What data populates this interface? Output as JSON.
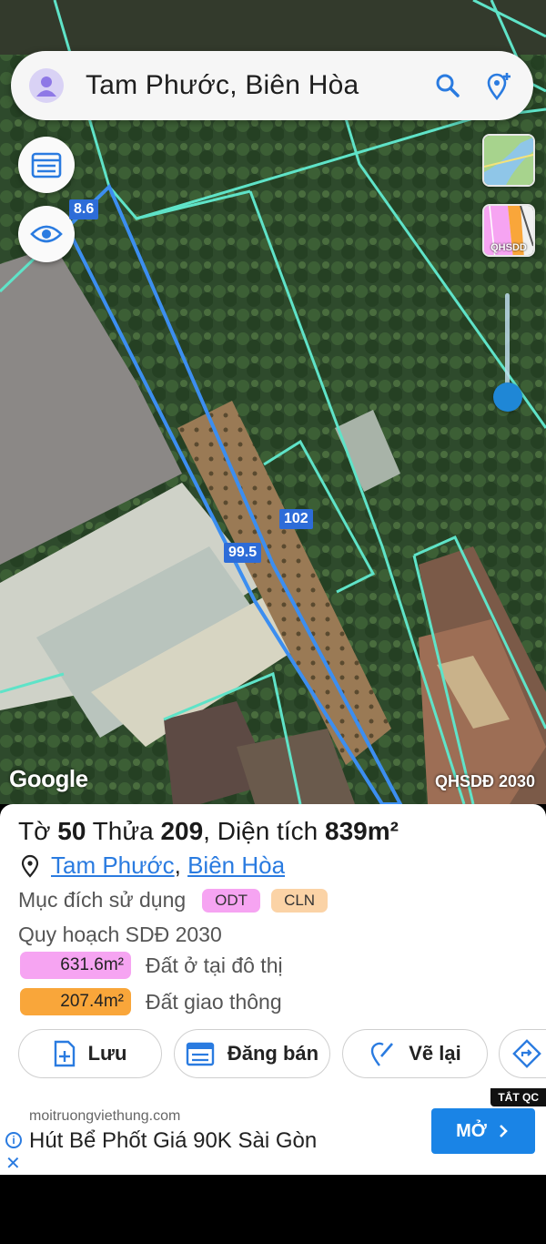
{
  "search": {
    "title": "Tam Phước, Biên Hòa"
  },
  "map": {
    "edge_labels": [
      "8.6",
      "102",
      "99.5"
    ],
    "layer_thumb_label": "QHSDD",
    "google_logo": "Google",
    "plan_badge": "QHSDĐ 2030",
    "colors": {
      "parcel_line": "#5fe3c8",
      "selected_parcel": "#3c8ef0"
    }
  },
  "parcel": {
    "title_prefix": "Tờ ",
    "sheet_no": "50",
    "parcel_prefix": " Thửa ",
    "parcel_no": "209",
    "area_prefix": ", Diện tích ",
    "area": "839m²",
    "ward": "Tam Phước",
    "separator": ",",
    "city": "Biên Hòa",
    "usage_label": "Mục đích sử dụng",
    "usage_tags": [
      {
        "code": "ODT",
        "color": "#f6a4f2"
      },
      {
        "code": "CLN",
        "color": "#fbd3a6"
      }
    ],
    "plan_label": "Quy hoạch SDĐ 2030",
    "plan_rows": [
      {
        "area": "631.6m²",
        "desc": "Đất ở tại đô thị",
        "color": "#f6a4f2"
      },
      {
        "area": "207.4m²",
        "desc": "Đất giao thông",
        "color": "#f9a63a"
      }
    ]
  },
  "actions": {
    "save": "Lưu",
    "sell": "Đăng bán",
    "redraw": "Vẽ lại"
  },
  "ad": {
    "tag": "TẮT QC",
    "domain": "moitruongviethung.com",
    "headline": "Hút Bể Phốt Giá 90K Sài Gòn",
    "cta": "MỞ"
  }
}
